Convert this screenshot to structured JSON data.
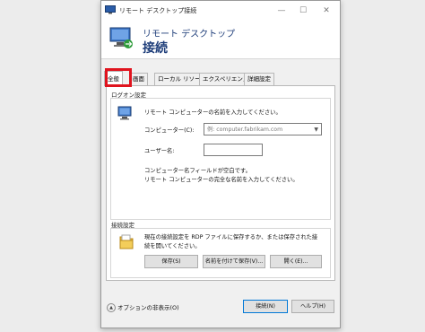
{
  "window": {
    "title": "リモート デスクトップ接続",
    "minimize_glyph": "—",
    "maximize_glyph": "☐",
    "close_glyph": "✕"
  },
  "header": {
    "title": "リモート デスクトップ",
    "subtitle": "接続"
  },
  "tabs": [
    {
      "label": "全般",
      "active": true
    },
    {
      "label": "画面",
      "active": false
    },
    {
      "label": "ローカル リソース",
      "active": false
    },
    {
      "label": "エクスペリエンス",
      "active": false
    },
    {
      "label": "詳細設定",
      "active": false
    }
  ],
  "logon": {
    "section_label": "ログオン設定",
    "intro": "リモート コンピューターの名前を入力してください。",
    "computer_label": "コンピューター(C):",
    "computer_placeholder": "例: computer.fabrikam.com",
    "user_label": "ユーザー名:",
    "user_value": "",
    "note_line1": "コンピューター名フィールドが空白です。",
    "note_line2": "リモート コンピューターの完全な名前を入力してください。"
  },
  "connection": {
    "section_label": "接続設定",
    "desc_line1": "現在の接続設定を RDP ファイルに保存するか、または保存された接",
    "desc_line2": "続を開いてください。",
    "save_label": "保存(S)",
    "save_as_label": "名前を付けて保存(V)...",
    "open_label": "開く(E)..."
  },
  "footer": {
    "options_label": "オプションの非表示(O)",
    "connect_label": "接続(N)",
    "help_label": "ヘルプ(H)"
  },
  "colors": {
    "accent": "#1f3e7a",
    "highlight": "#e0141e",
    "default_button_border": "#0078d7"
  }
}
